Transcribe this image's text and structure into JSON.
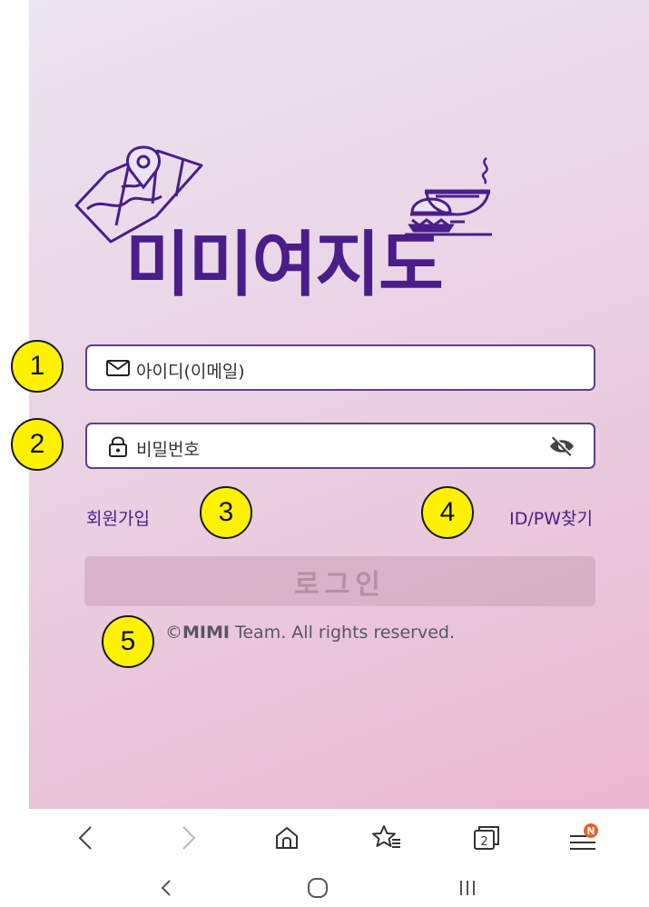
{
  "app": {
    "logo_text": "미미여지도",
    "id_placeholder": "아이디(이메일)",
    "pw_placeholder": "비밀번호",
    "signup_label": "회원가입",
    "find_label": "ID/PW찾기",
    "login_label": "로그인",
    "copyright_symbol": "©",
    "copyright_brand": "MIMI",
    "copyright_rest": " Team. All rights reserved."
  },
  "markers": [
    "1",
    "2",
    "3",
    "4",
    "5"
  ],
  "browser_bar": {
    "icons": [
      "back-icon",
      "forward-icon",
      "home-icon",
      "bookmarks-icon",
      "tabs-icon",
      "menu-icon"
    ],
    "tabs_count": "2",
    "menu_badge": "N"
  },
  "system_nav": {
    "icons": [
      "nav-back-icon",
      "nav-home-icon",
      "nav-recents-icon"
    ]
  },
  "colors": {
    "brand": "#4a1d8a",
    "field_border": "#5e3f88",
    "marker": "#fff200",
    "badge": "#e8602c"
  }
}
